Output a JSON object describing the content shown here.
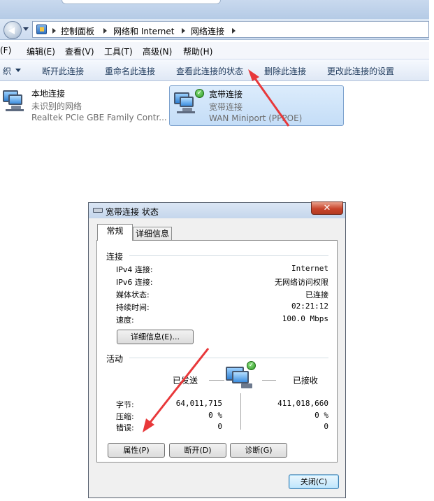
{
  "explorer": {
    "breadcrumb": [
      "控制面板",
      "网络和 Internet",
      "网络连接"
    ],
    "menu": [
      "(F)",
      "编辑(E)",
      "查看(V)",
      "工具(T)",
      "高级(N)",
      "帮助(H)"
    ],
    "commands": {
      "organize": "织",
      "disconnect": "断开此连接",
      "rename": "重命名此连接",
      "view_status": "查看此连接的状态",
      "delete": "删除此连接",
      "change_settings": "更改此连接的设置"
    },
    "connections": [
      {
        "name": "本地连接",
        "status": "未识别的网络",
        "device": "Realtek PCIe GBE Family Contr..."
      },
      {
        "name": "宽带连接",
        "status": "宽带连接",
        "device": "WAN Miniport (PPPOE)"
      }
    ]
  },
  "dialog": {
    "title": "宽带连接 状态",
    "close_glyph": "✕",
    "tabs": [
      "常规",
      "详细信息"
    ],
    "connection": {
      "heading": "连接",
      "rows": [
        {
          "label": "IPv4 连接:",
          "value": "Internet"
        },
        {
          "label": "IPv6 连接:",
          "value": "无网络访问权限"
        },
        {
          "label": "媒体状态:",
          "value": "已连接"
        },
        {
          "label": "持续时间:",
          "value": "02:21:12"
        },
        {
          "label": "速度:",
          "value": "100.0 Mbps"
        }
      ],
      "details_button": "详细信息(E)..."
    },
    "activity": {
      "heading": "活动",
      "sent_label": "已发送",
      "received_label": "已接收",
      "rows": [
        {
          "label": "字节:",
          "sent": "64,011,715",
          "received": "411,018,660"
        },
        {
          "label": "压缩:",
          "sent": "0 %",
          "received": "0 %"
        },
        {
          "label": "错误:",
          "sent": "0",
          "received": "0"
        }
      ]
    },
    "buttons": {
      "properties": "属性(P)",
      "disconnect": "断开(D)",
      "diagnose": "诊断(G)",
      "close": "关闭(C)"
    }
  },
  "colors": {
    "annotation_arrow": "#e8383a",
    "check_green": "#2e9a24"
  },
  "icons": [
    "back-icon",
    "control-panel-icon",
    "network-connection-icon",
    "check-icon",
    "modem-icon"
  ]
}
